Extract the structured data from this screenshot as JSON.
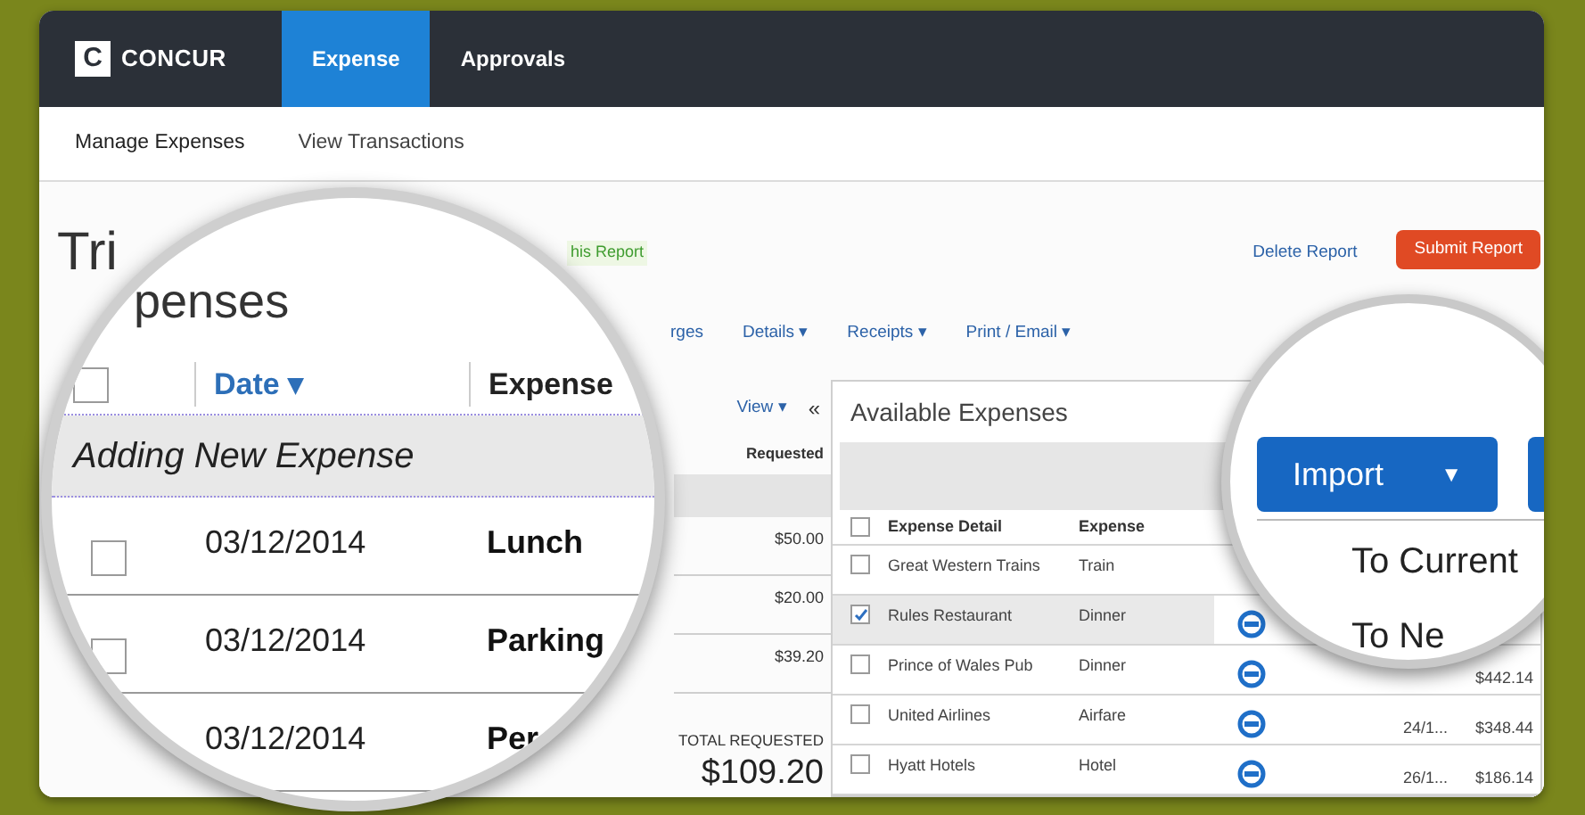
{
  "header": {
    "logo_mark": "C",
    "logo_text": "CONCUR",
    "tabs": [
      {
        "label": "Expense",
        "selected": true
      },
      {
        "label": "Approvals",
        "selected": false
      }
    ]
  },
  "subnav": [
    {
      "label": "Manage Expenses",
      "selected": true
    },
    {
      "label": "View Transactions",
      "selected": false
    }
  ],
  "report": {
    "title": "Tri",
    "link": "his Report",
    "actions": [
      {
        "label": "Delete Report",
        "kind": "link"
      },
      {
        "label": "Submit Report",
        "kind": "primary"
      }
    ]
  },
  "toolbar": [
    "rges",
    "Details ▾",
    "Receipts ▾",
    "Print / Email ▾"
  ],
  "expense_list": {
    "view": "View ▾",
    "collapse": "«",
    "column": "Requested",
    "amounts": [
      "$50.00",
      "$20.00",
      "$39.20"
    ],
    "total_label": "TOTAL REQUESTED",
    "total": "$109.20"
  },
  "available": {
    "title": "Available Expenses",
    "all_checked": false,
    "columns": [
      "Expense Detail",
      "Expense"
    ],
    "rows": [
      {
        "detail": "Great Western Trains",
        "expense": "Train",
        "checked": false,
        "selected": false
      },
      {
        "detail": "Rules Restaurant",
        "expense": "Dinner",
        "checked": true,
        "selected": true,
        "receipt": true
      },
      {
        "detail": "Prince of Wales Pub",
        "expense": "Dinner",
        "checked": false,
        "selected": false,
        "receipt": true,
        "amount": "$442.14"
      },
      {
        "detail": "United Airlines",
        "expense": "Airfare",
        "checked": false,
        "selected": false,
        "receipt": true,
        "date": "24/1...",
        "amount": "$348.44"
      },
      {
        "detail": "Hyatt Hotels",
        "expense": "Hotel",
        "checked": false,
        "selected": false,
        "receipt": true,
        "date": "26/1...",
        "amount": "$186.14"
      }
    ]
  },
  "magnifier_left": {
    "heading": "penses",
    "all_checked": false,
    "columns": [
      "Date ▾",
      "Expense"
    ],
    "new_row": "Adding New Expense",
    "rows": [
      {
        "date": "03/12/2014",
        "expense": "Lunch",
        "checked": false
      },
      {
        "date": "03/12/2014",
        "expense": "Parking",
        "checked": false
      },
      {
        "date": "03/12/2014",
        "expense": "Per"
      }
    ]
  },
  "magnifier_right": {
    "button": "Import",
    "caret": "▼",
    "menu": [
      "To Current",
      "To Ne"
    ]
  }
}
